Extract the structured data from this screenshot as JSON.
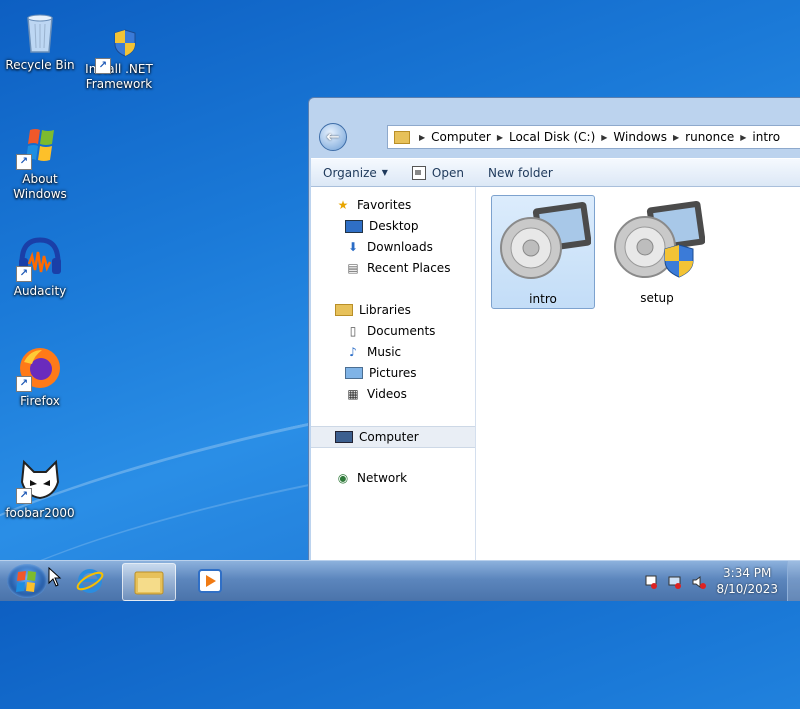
{
  "desktop": {
    "icons": [
      {
        "label": "Recycle Bin",
        "icon": "recycle-bin-icon"
      },
      {
        "label": "Install .NET Framework",
        "icon": "dotnet-installer-icon"
      },
      {
        "label": "About Windows",
        "icon": "windows-logo-icon"
      },
      {
        "label": "Audacity",
        "icon": "audacity-icon"
      },
      {
        "label": "Firefox",
        "icon": "firefox-icon"
      },
      {
        "label": "foobar2000",
        "icon": "foobar2000-icon"
      }
    ]
  },
  "explorer": {
    "breadcrumb": [
      "Computer",
      "Local Disk (C:)",
      "Windows",
      "runonce",
      "intro"
    ],
    "toolbar": {
      "organize": "Organize",
      "open": "Open",
      "new_folder": "New folder"
    },
    "nav": {
      "favorites": "Favorites",
      "desktop": "Desktop",
      "downloads": "Downloads",
      "recent_places": "Recent Places",
      "libraries": "Libraries",
      "documents": "Documents",
      "music": "Music",
      "pictures": "Pictures",
      "videos": "Videos",
      "computer": "Computer",
      "network": "Network"
    },
    "files": [
      {
        "name": "intro",
        "selected": true
      },
      {
        "name": "setup",
        "selected": false
      }
    ]
  },
  "taskbar": {
    "time": "3:34 PM",
    "date": "8/10/2023"
  }
}
